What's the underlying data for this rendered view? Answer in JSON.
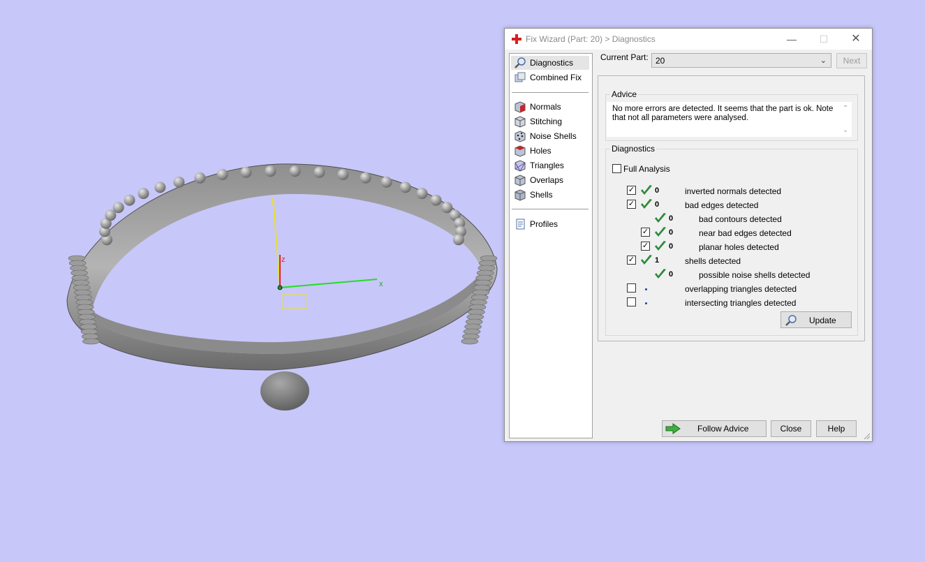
{
  "viewport": {
    "axis_labels": {
      "x": "x",
      "y": "y",
      "z": "z"
    },
    "axis_colors": {
      "x": "#22dd22",
      "y": "#e8e030",
      "z": "#dd2222"
    },
    "background": "#c7c7fa"
  },
  "dialog": {
    "title": "Fix Wizard (Part: 20) > Diagnostics",
    "app_icon": "red-cross-icon",
    "window_buttons": {
      "minimize": "—",
      "maximize": "☐",
      "close": "✕"
    },
    "nav": {
      "top": [
        {
          "label": "Diagnostics",
          "icon": "magnifier-icon",
          "active": true
        },
        {
          "label": "Combined Fix",
          "icon": "combined-fix-icon"
        }
      ],
      "tools": [
        {
          "label": "Normals",
          "icon": "normals-cube-icon"
        },
        {
          "label": "Stitching",
          "icon": "stitching-cube-icon"
        },
        {
          "label": "Noise Shells",
          "icon": "noise-shells-icon"
        },
        {
          "label": "Holes",
          "icon": "holes-cube-icon"
        },
        {
          "label": "Triangles",
          "icon": "triangles-cube-icon"
        },
        {
          "label": "Overlaps",
          "icon": "overlaps-cube-icon"
        },
        {
          "label": "Shells",
          "icon": "shells-cube-icon"
        }
      ],
      "bottom": [
        {
          "label": "Profiles",
          "icon": "document-icon"
        }
      ]
    },
    "current_part_label": "Current Part:",
    "current_part_value": "20",
    "next_label": "Next",
    "advice": {
      "title": "Advice",
      "text": "No more errors are detected. It seems that the part is ok. Note that not all parameters were analysed."
    },
    "diagnostics": {
      "title": "Diagnostics",
      "full_analysis_label": "Full Analysis",
      "full_analysis_checked": false,
      "rows": [
        {
          "checked": true,
          "status": "ok",
          "count": "0",
          "label": "inverted normals detected",
          "indent": 0
        },
        {
          "checked": true,
          "status": "ok",
          "count": "0",
          "label": "bad edges detected",
          "indent": 0
        },
        {
          "checked": null,
          "status": "ok",
          "count": "0",
          "label": "bad contours detected",
          "indent": 1
        },
        {
          "checked": true,
          "status": "ok",
          "count": "0",
          "label": "near bad edges detected",
          "indent": 1
        },
        {
          "checked": true,
          "status": "ok",
          "count": "0",
          "label": "planar holes detected",
          "indent": 1
        },
        {
          "checked": true,
          "status": "ok",
          "count": "1",
          "label": "shells detected",
          "indent": 0
        },
        {
          "checked": null,
          "status": "ok",
          "count": "0",
          "label": "possible noise shells detected",
          "indent": 1
        },
        {
          "checked": false,
          "status": "pending",
          "count": "",
          "label": "overlapping triangles detected",
          "indent": 0
        },
        {
          "checked": false,
          "status": "pending",
          "count": "",
          "label": "intersecting triangles detected",
          "indent": 0
        }
      ],
      "update_label": "Update"
    },
    "buttons": {
      "follow_advice": "Follow Advice",
      "close": "Close",
      "help": "Help"
    }
  }
}
